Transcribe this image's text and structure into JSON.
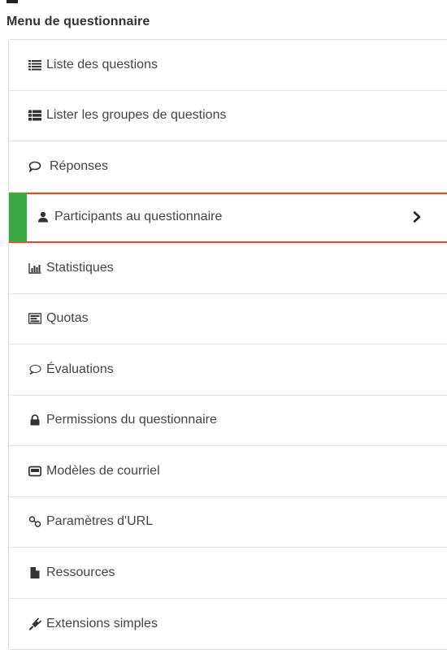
{
  "menu": {
    "title": "Menu de questionnaire",
    "items": [
      {
        "label": "Liste des questions",
        "icon": "list-icon"
      },
      {
        "label": "Lister les groupes de questions",
        "icon": "list-groups-icon"
      },
      {
        "label": "Réponses",
        "icon": "comment-icon"
      },
      {
        "label": "Participants au questionnaire",
        "icon": "user-icon",
        "active": true
      },
      {
        "label": "Statistiques",
        "icon": "bar-chart-icon"
      },
      {
        "label": "Quotas",
        "icon": "quotas-icon"
      },
      {
        "label": "Évaluations",
        "icon": "comment-outline-icon"
      },
      {
        "label": "Permissions du questionnaire",
        "icon": "lock-icon"
      },
      {
        "label": "Modèles de courriel",
        "icon": "envelope-icon"
      },
      {
        "label": "Paramètres d'URL",
        "icon": "link-icon"
      },
      {
        "label": "Ressources",
        "icon": "file-icon"
      },
      {
        "label": "Extensions simples",
        "icon": "plug-icon"
      }
    ]
  },
  "colors": {
    "active_bar": "#3aa946",
    "active_outline": "#e8452c"
  }
}
